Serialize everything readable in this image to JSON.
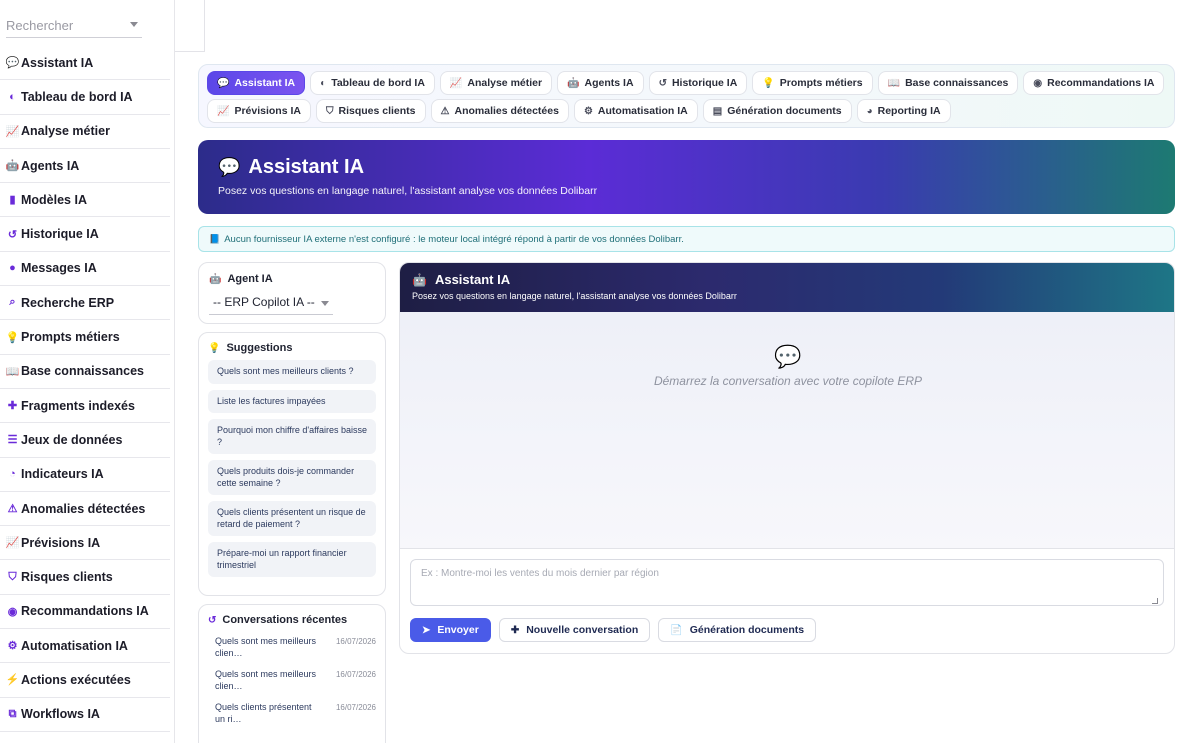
{
  "search": {
    "placeholder": "Rechercher"
  },
  "sidebar": {
    "items": [
      {
        "label": "Assistant IA",
        "icon": "chat-icon"
      },
      {
        "label": "Tableau de bord IA",
        "icon": "dashboard-icon"
      },
      {
        "label": "Analyse métier",
        "icon": "chart-line-icon"
      },
      {
        "label": "Agents IA",
        "icon": "robot-icon"
      },
      {
        "label": "Modèles IA",
        "icon": "book-icon"
      },
      {
        "label": "Historique IA",
        "icon": "history-icon"
      },
      {
        "label": "Messages IA",
        "icon": "message-icon"
      },
      {
        "label": "Recherche ERP",
        "icon": "search-icon"
      },
      {
        "label": "Prompts métiers",
        "icon": "lightbulb-icon"
      },
      {
        "label": "Base connaissances",
        "icon": "open-book-icon"
      },
      {
        "label": "Fragments indexés",
        "icon": "puzzle-icon"
      },
      {
        "label": "Jeux de données",
        "icon": "database-icon"
      },
      {
        "label": "Indicateurs IA",
        "icon": "gauge-icon"
      },
      {
        "label": "Anomalies détectées",
        "icon": "warning-icon"
      },
      {
        "label": "Prévisions IA",
        "icon": "chart-line-icon"
      },
      {
        "label": "Risques clients",
        "icon": "shield-icon"
      },
      {
        "label": "Recommandations IA",
        "icon": "brain-icon"
      },
      {
        "label": "Automatisation IA",
        "icon": "gears-icon"
      },
      {
        "label": "Actions exécutées",
        "icon": "bolt-icon"
      },
      {
        "label": "Workflows IA",
        "icon": "workflow-icon"
      }
    ]
  },
  "tabs": {
    "row1": [
      {
        "label": "Assistant IA",
        "icon": "chat-icon",
        "active": true
      },
      {
        "label": "Tableau de bord IA",
        "icon": "dashboard-icon"
      },
      {
        "label": "Analyse métier",
        "icon": "chart-line-icon"
      },
      {
        "label": "Agents IA",
        "icon": "robot-icon"
      },
      {
        "label": "Historique IA",
        "icon": "history-icon"
      },
      {
        "label": "Prompts métiers",
        "icon": "lightbulb-icon"
      },
      {
        "label": "Base connaissances",
        "icon": "open-book-icon"
      },
      {
        "label": "Recommandations IA",
        "icon": "brain-icon"
      }
    ],
    "row2": [
      {
        "label": "Prévisions IA",
        "icon": "chart-line-icon"
      },
      {
        "label": "Risques clients",
        "icon": "shield-icon"
      },
      {
        "label": "Anomalies détectées",
        "icon": "warning-icon"
      },
      {
        "label": "Automatisation IA",
        "icon": "gears-icon"
      },
      {
        "label": "Génération documents",
        "icon": "document-icon"
      },
      {
        "label": "Reporting IA",
        "icon": "pie-chart-icon"
      }
    ]
  },
  "hero": {
    "title": "Assistant IA",
    "subtitle": "Posez vos questions en langage naturel, l'assistant analyse vos données Dolibarr"
  },
  "info": {
    "text": "Aucun fournisseur IA externe n'est configuré : le moteur local intégré répond à partir de vos données Dolibarr."
  },
  "agent": {
    "title": "Agent IA",
    "selected": "-- ERP Copilot IA --"
  },
  "suggestions": {
    "title": "Suggestions",
    "items": [
      "Quels sont mes meilleurs clients ?",
      "Liste les factures impayées",
      "Pourquoi mon chiffre d'affaires baisse ?",
      "Quels produits dois-je commander cette semaine ?",
      "Quels clients présentent un risque de retard de paiement ?",
      "Prépare-moi un rapport financier trimestriel"
    ]
  },
  "recent": {
    "title": "Conversations récentes",
    "items": [
      {
        "text": "Quels sont mes meilleurs clien…",
        "date": "16/07/2026"
      },
      {
        "text": "Quels sont mes meilleurs clien…",
        "date": "16/07/2026"
      },
      {
        "text": "Quels clients présentent un ri…",
        "date": "16/07/2026"
      }
    ]
  },
  "chat": {
    "title": "Assistant IA",
    "subtitle": "Posez vos questions en langage naturel, l'assistant analyse vos données Dolibarr",
    "empty": "Démarrez la conversation avec votre copilote ERP",
    "placeholder": "Ex : Montre-moi les ventes du mois dernier par région",
    "send": "Envoyer",
    "new": "Nouvelle conversation",
    "docs": "Génération documents"
  },
  "colors": {
    "accent": "#5b47e8",
    "primary_button": "#4a5be8",
    "info_text": "#1f6f78"
  }
}
